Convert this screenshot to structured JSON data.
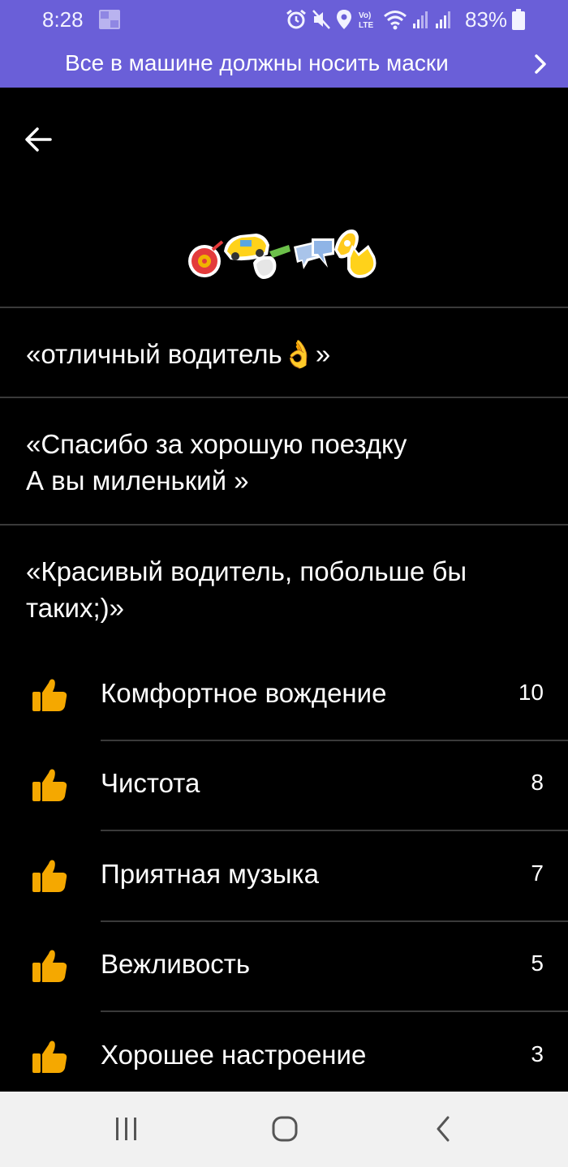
{
  "status_bar": {
    "time": "8:28",
    "battery": "83%",
    "icons": [
      "gallery-icon",
      "alarm-icon",
      "mute-icon",
      "location-icon",
      "volte-icon",
      "wifi-icon",
      "signal-icon",
      "signal-icon",
      "battery-icon"
    ],
    "volte_label": "Vo)\nLTE"
  },
  "banner": {
    "text": "Все в машине должны носить маски",
    "icon": "chevron-right-icon"
  },
  "header": {
    "back_icon": "arrow-left-icon",
    "stickers_icon": "sticker-pack-icon"
  },
  "reviews": [
    {
      "text": "«отличный водитель👌»"
    },
    {
      "line1": "«Спасибо за хорошую поездку",
      "line2": "А вы миленький »"
    },
    {
      "line1": "«Красивый водитель, побольше бы",
      "line2": "таких;)»"
    }
  ],
  "tags": [
    {
      "label": "Комфортное вождение",
      "count": "10"
    },
    {
      "label": "Чистота",
      "count": "8"
    },
    {
      "label": "Приятная музыка",
      "count": "7"
    },
    {
      "label": "Вежливость",
      "count": "5"
    },
    {
      "label": "Хорошее настроение",
      "count": "3"
    }
  ],
  "colors": {
    "banner": "#6a5fd8",
    "background": "#000000",
    "thumb": "#f5a800",
    "navbar": "#f1f1f1"
  },
  "navbar": {
    "icons": [
      "recent-apps-icon",
      "home-icon",
      "back-icon"
    ]
  }
}
